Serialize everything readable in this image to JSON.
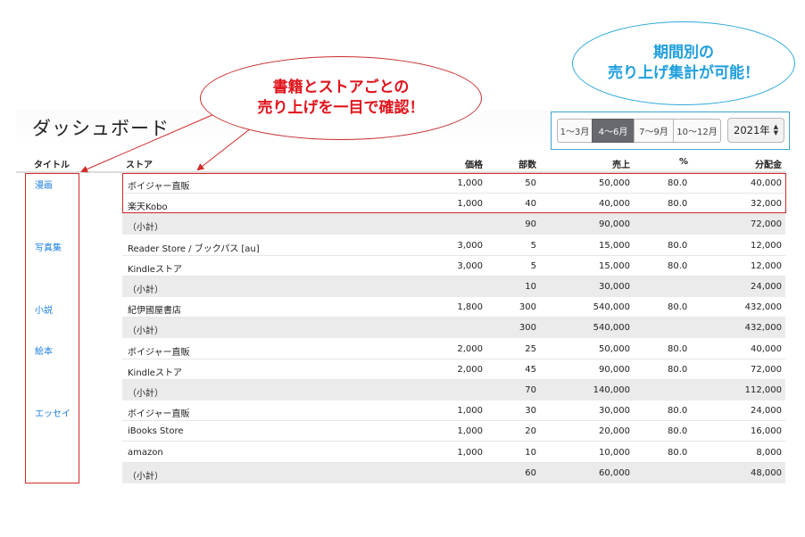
{
  "dashboard": {
    "title": "ダッシュボード"
  },
  "period_tabs": [
    "1〜3月",
    "4〜6月",
    "7〜9月",
    "10〜12月"
  ],
  "active_tab": "4〜6月",
  "year_select": {
    "value": "2021年"
  },
  "columns": {
    "title": "タイトル",
    "store": "ストア",
    "price": "価格",
    "copies": "部数",
    "sales": "売上",
    "percent": "%",
    "distribution": "分配金"
  },
  "titles": [
    "漫画",
    "写真集",
    "小説",
    "絵本",
    "エッセイ"
  ],
  "rows": [
    {
      "store": "ボイジャー直販",
      "price": "1,000",
      "copies": "50",
      "sales": "50,000",
      "percent": "80.0",
      "dist": "40,000"
    },
    {
      "store": "楽天Kobo",
      "price": "1,000",
      "copies": "40",
      "sales": "40,000",
      "percent": "80.0",
      "dist": "32,000"
    },
    {
      "store": "（小計）",
      "price": "",
      "copies": "90",
      "sales": "90,000",
      "percent": "",
      "dist": "72,000"
    },
    {
      "store": "Reader Store / ブックパス [au]",
      "price": "3,000",
      "copies": "5",
      "sales": "15,000",
      "percent": "80.0",
      "dist": "12,000"
    },
    {
      "store": "Kindleストア",
      "price": "3,000",
      "copies": "5",
      "sales": "15,000",
      "percent": "80.0",
      "dist": "12,000"
    },
    {
      "store": "（小計）",
      "price": "",
      "copies": "10",
      "sales": "30,000",
      "percent": "",
      "dist": "24,000"
    },
    {
      "store": "紀伊國屋書店",
      "price": "1,800",
      "copies": "300",
      "sales": "540,000",
      "percent": "80.0",
      "dist": "432,000"
    },
    {
      "store": "（小計）",
      "price": "",
      "copies": "300",
      "sales": "540,000",
      "percent": "",
      "dist": "432,000"
    },
    {
      "store": "ボイジャー直販",
      "price": "2,000",
      "copies": "25",
      "sales": "50,000",
      "percent": "80.0",
      "dist": "40,000"
    },
    {
      "store": "Kindleストア",
      "price": "2,000",
      "copies": "45",
      "sales": "90,000",
      "percent": "80.0",
      "dist": "72,000"
    },
    {
      "store": "（小計）",
      "price": "",
      "copies": "70",
      "sales": "140,000",
      "percent": "",
      "dist": "112,000"
    },
    {
      "store": "ボイジャー直販",
      "price": "1,000",
      "copies": "30",
      "sales": "30,000",
      "percent": "80.0",
      "dist": "24,000"
    },
    {
      "store": "iBooks Store",
      "price": "1,000",
      "copies": "20",
      "sales": "20,000",
      "percent": "80.0",
      "dist": "16,000"
    },
    {
      "store": "amazon",
      "price": "1,000",
      "copies": "10",
      "sales": "10,000",
      "percent": "80.0",
      "dist": "8,000"
    },
    {
      "store": "（小計）",
      "price": "",
      "copies": "60",
      "sales": "60,000",
      "percent": "",
      "dist": "48,000"
    }
  ],
  "callouts": {
    "store_sales": [
      "書籍とストアごとの",
      "売り上げを一目で確認！"
    ],
    "period_sales": [
      "期間別の",
      "売り上げ集計が可能！"
    ]
  },
  "colors": {
    "accent_red": "#d42a2a",
    "accent_blue": "#2ea8dc",
    "link_blue": "#1a7ee0"
  }
}
